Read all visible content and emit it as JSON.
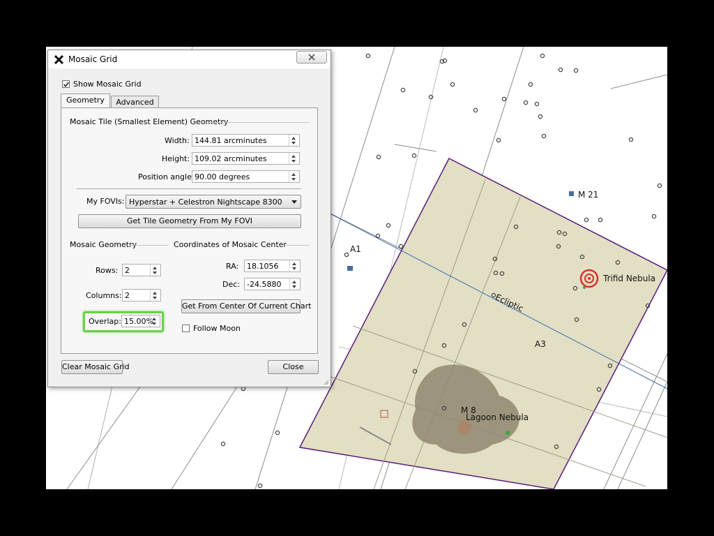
{
  "dialog": {
    "title": "Mosaic Grid",
    "show_mosaic_grid": {
      "label": "Show Mosaic Grid",
      "checked": true
    },
    "tabs": [
      {
        "label": "Geometry",
        "active": true
      },
      {
        "label": "Advanced",
        "active": false
      }
    ],
    "tile_section": "Mosaic Tile (Smallest Element) Geometry",
    "width": {
      "label": "Width:",
      "value": "144.81 arcminutes"
    },
    "height": {
      "label": "Height:",
      "value": "109.02 arcminutes"
    },
    "position_angle": {
      "label": "Position angle:",
      "value": "90.00 degrees"
    },
    "my_fovis": {
      "label": "My FOVIs:",
      "value": "Hyperstar + Celestron Nightscape 8300"
    },
    "get_tile_button": "Get Tile Geometry From My FOVI",
    "mosaic_section": "Mosaic Geometry",
    "center_section": "Coordinates of Mosaic Center",
    "rows": {
      "label": "Rows:",
      "value": "2"
    },
    "columns": {
      "label": "Columns:",
      "value": "2"
    },
    "overlap": {
      "label": "Overlap:",
      "value": "15.00%"
    },
    "ra": {
      "label": "RA:",
      "value": "18.1056"
    },
    "dec": {
      "label": "Dec:",
      "value": "-24.5880"
    },
    "get_center_button": "Get From Center Of Current Chart",
    "follow_moon": {
      "label": "Follow Moon",
      "checked": false
    },
    "clear_button": "Clear Mosaic Grid",
    "close_button": "Close"
  },
  "sky_chart": {
    "labels": {
      "m21": "M 21",
      "trifid": "Trifid Nebula",
      "a1": "A1",
      "ecliptic": "Ecliptic",
      "a3": "A3",
      "m8": "M 8",
      "lagoon": "Lagoon Nebula"
    },
    "colors": {
      "mosaic_fill": "#e2dfc4",
      "mosaic_border": "#5a1a78",
      "ecliptic": "#3a6db0",
      "grid": "#8c8c8c",
      "trifid": "#d6312a"
    }
  }
}
